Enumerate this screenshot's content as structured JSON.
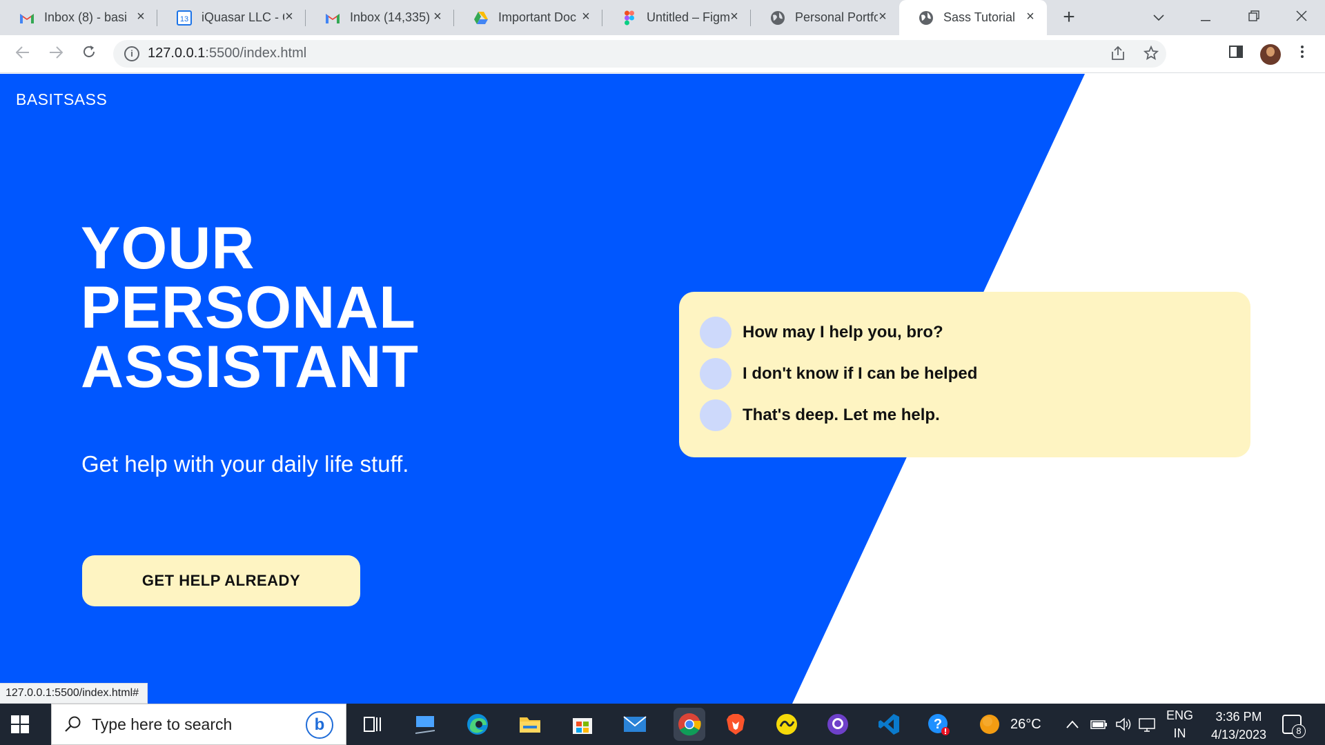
{
  "browser": {
    "tabs": [
      {
        "title": "Inbox (8) - basi",
        "icon": "gmail-icon",
        "active": false
      },
      {
        "title": "iQuasar LLC - C",
        "icon": "calendar-icon",
        "active": false
      },
      {
        "title": "Inbox (14,335)",
        "icon": "gmail-icon",
        "active": false
      },
      {
        "title": "Important Doc",
        "icon": "google-drive-icon",
        "active": false
      },
      {
        "title": "Untitled – Figm",
        "icon": "figma-icon",
        "active": false
      },
      {
        "title": "Personal Portfo",
        "icon": "globe-icon",
        "active": false
      },
      {
        "title": "Sass Tutorial",
        "icon": "globe-icon",
        "active": true
      }
    ],
    "calendar_day": "13",
    "url_host": "127.0.0.1",
    "url_path": ":5500/index.html"
  },
  "page": {
    "brand": "BASITSASS",
    "hero_lines": [
      "YOUR",
      "PERSONAL",
      "ASSISTANT"
    ],
    "subtitle": "Get help with your daily life stuff.",
    "cta_label": "GET HELP ALREADY",
    "messages": [
      "How may I help you, bro?",
      "I don't know if I can be helped",
      "That's deep. Let me help."
    ],
    "status_url": "127.0.0.1:5500/index.html#"
  },
  "taskbar": {
    "search_placeholder": "Type here to search",
    "temperature": "26°C",
    "lang_top": "ENG",
    "lang_bottom": "IN",
    "time": "3:36 PM",
    "date": "4/13/2023",
    "notification_count": "8"
  },
  "colors": {
    "accent_blue": "#0057ff",
    "card_yellow": "#fef4c2",
    "dot_blue": "#cdd9fb"
  }
}
